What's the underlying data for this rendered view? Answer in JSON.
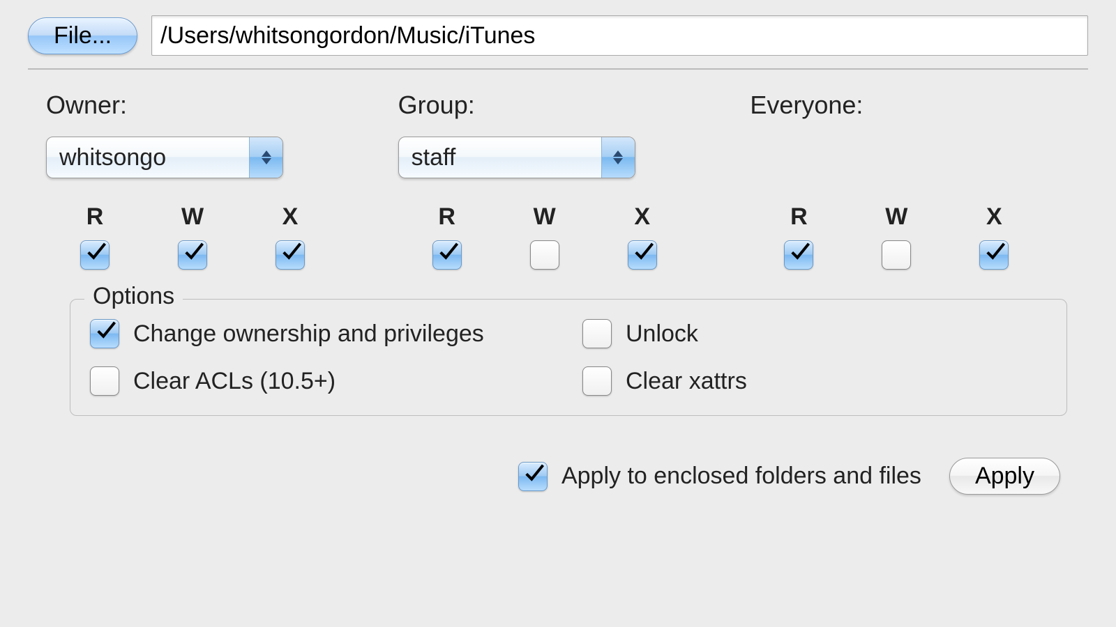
{
  "top": {
    "file_button": "File...",
    "path": "/Users/whitsongordon/Music/iTunes"
  },
  "columns": {
    "owner": {
      "label": "Owner:",
      "selected": "whitsongo"
    },
    "group": {
      "label": "Group:",
      "selected": "staff"
    },
    "everyone": {
      "label": "Everyone:"
    }
  },
  "rwx_letters": {
    "r": "R",
    "w": "W",
    "x": "X"
  },
  "perms": {
    "owner": {
      "r": true,
      "w": true,
      "x": true
    },
    "group": {
      "r": true,
      "w": false,
      "x": true
    },
    "everyone": {
      "r": true,
      "w": false,
      "x": true
    }
  },
  "options": {
    "legend": "Options",
    "change_label": "Change ownership and privileges",
    "change_checked": true,
    "unlock_label": "Unlock",
    "unlock_checked": false,
    "clear_acls_label": "Clear ACLs (10.5+)",
    "clear_acls_checked": false,
    "clear_xattrs_label": "Clear xattrs",
    "clear_xattrs_checked": false
  },
  "bottom": {
    "apply_enclosed_label": "Apply to enclosed folders and files",
    "apply_enclosed_checked": true,
    "apply_button": "Apply"
  }
}
